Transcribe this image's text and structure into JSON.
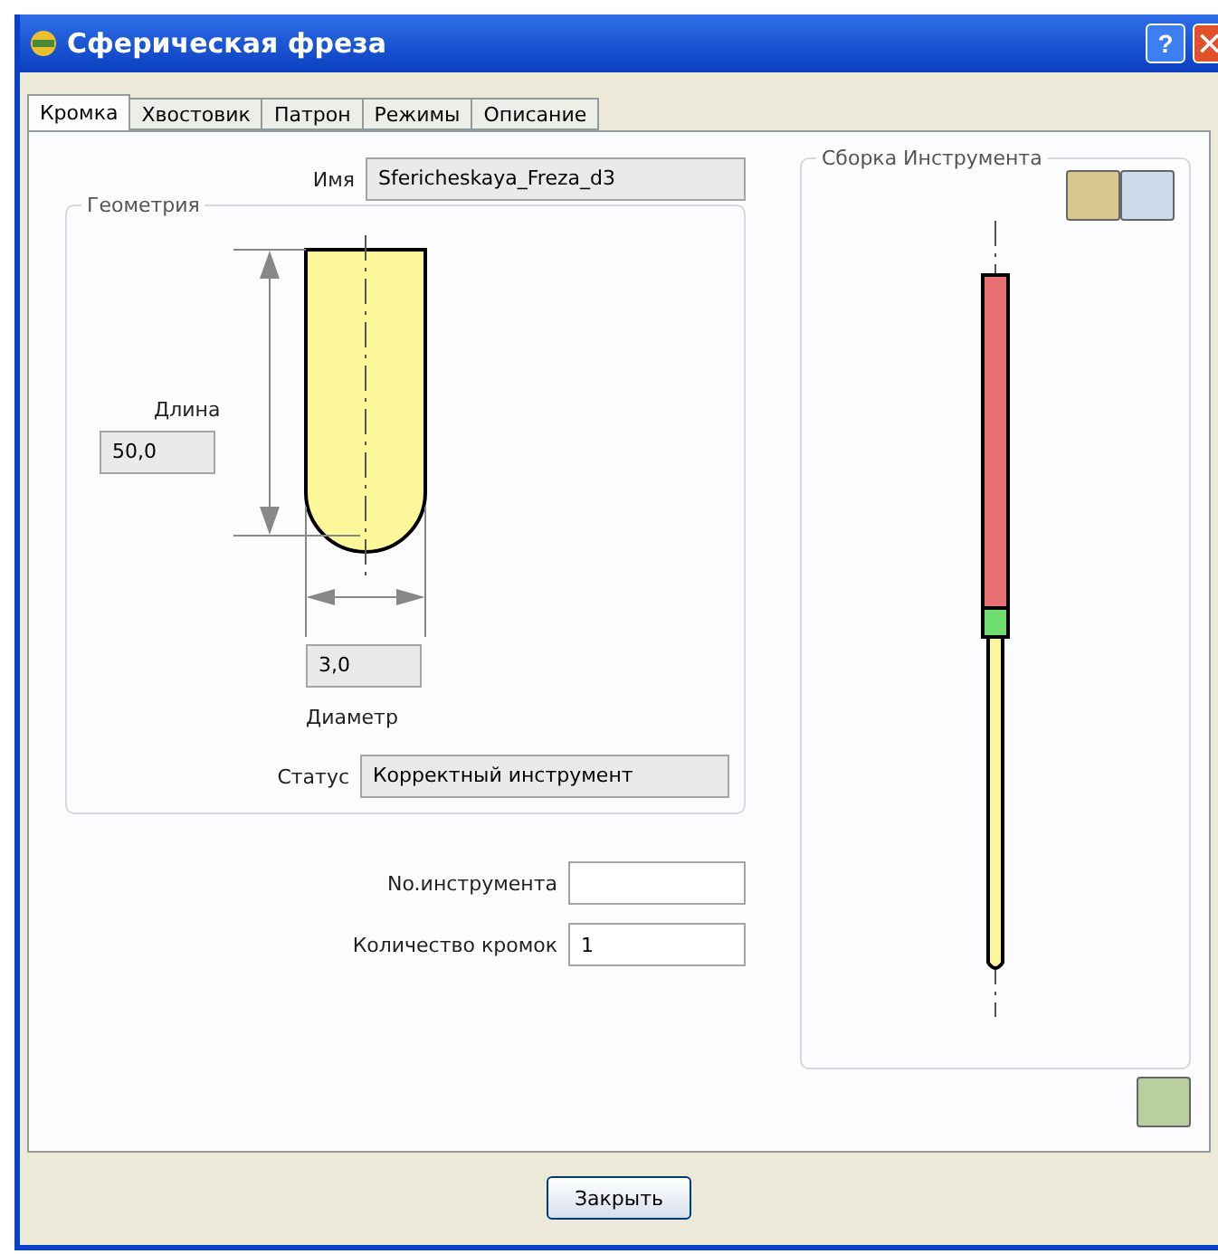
{
  "window": {
    "title": "Сферическая фреза",
    "help": "?"
  },
  "tabs": [
    {
      "label": "Кромка",
      "selected": true
    },
    {
      "label": "Хвостовик",
      "selected": false
    },
    {
      "label": "Патрон",
      "selected": false
    },
    {
      "label": "Режимы",
      "selected": false
    },
    {
      "label": "Описание",
      "selected": false
    }
  ],
  "name": {
    "label": "Имя",
    "value": "Sfericheskaya_Freza_d3"
  },
  "geometry": {
    "title": "Геометрия",
    "length_label": "Длина",
    "length_value": "50,0",
    "diameter_value": "3,0",
    "diameter_label": "Диаметр",
    "status_label": "Статус",
    "status_value": "Корректный инструмент"
  },
  "tool_number": {
    "label": "No.инструмента"
  },
  "edge_count": {
    "label": "Количество кромок",
    "value": "1"
  },
  "assembly": {
    "title": "Сборка Инструмента"
  },
  "buttons": [
    "Закрыть"
  ]
}
